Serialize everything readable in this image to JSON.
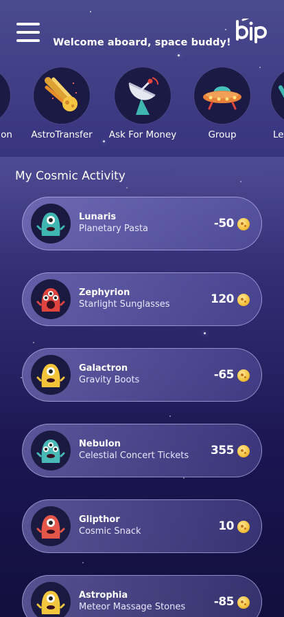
{
  "header": {
    "welcome": "Welcome aboard, space buddy!",
    "logo_text": "bip",
    "menu_icon": "hamburger-menu-icon"
  },
  "actions": [
    {
      "label": "on",
      "icon": "partial-action-icon"
    },
    {
      "label": "AstroTransfer",
      "icon": "comet-icon"
    },
    {
      "label": "Ask For Money",
      "icon": "satellite-dish-icon"
    },
    {
      "label": "Group",
      "icon": "ufo-icon"
    },
    {
      "label": "Let",
      "icon": "partial-action-icon"
    }
  ],
  "activity": {
    "title": "My Cosmic Activity",
    "transactions": [
      {
        "name": "Lunaris",
        "item": "Planetary Pasta",
        "amount": "-50",
        "avatar": "teal-alien-avatar",
        "avatar_color": "#3fb6b0"
      },
      {
        "name": "Zephyrion",
        "item": "Starlight Sunglasses",
        "amount": "120",
        "avatar": "red-screaming-alien-avatar",
        "avatar_color": "#e0443e"
      },
      {
        "name": "Galactron",
        "item": "Gravity Boots",
        "amount": "-65",
        "avatar": "yellow-alien-avatar",
        "avatar_color": "#f3c43a"
      },
      {
        "name": "Nebulon",
        "item": "Celestial Concert Tickets",
        "amount": "355",
        "avatar": "teal-tall-alien-avatar",
        "avatar_color": "#48b9b4"
      },
      {
        "name": "Glipthor",
        "item": "Cosmic Snack",
        "amount": "10",
        "avatar": "red-worm-alien-avatar",
        "avatar_color": "#e4554a"
      },
      {
        "name": "Astrophia",
        "item": "Meteor Massage Stones",
        "amount": "-85",
        "avatar": "yellow-cyclops-alien-avatar",
        "avatar_color": "#f2c73f"
      }
    ]
  },
  "colors": {
    "background_top": "#4a4a8e",
    "background_bottom": "#120f3e",
    "coin": "#f5c542"
  }
}
